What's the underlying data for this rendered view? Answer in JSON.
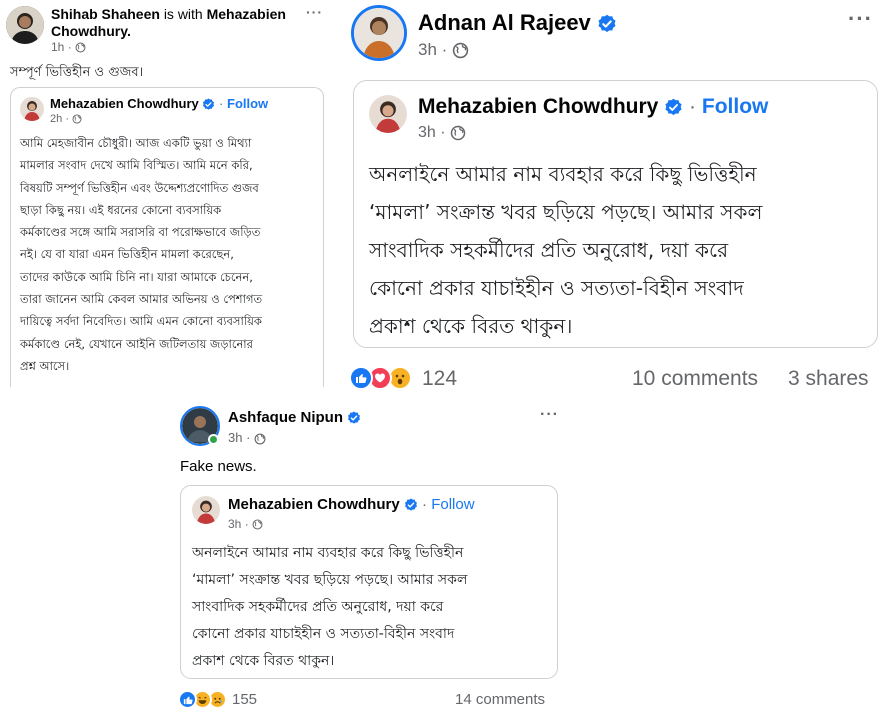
{
  "post1": {
    "author": "Shihab Shaheen",
    "with_text": "is with",
    "tagged": "Mehazabien Chowdhury.",
    "tagged_line1": "Mehazabien",
    "tagged_line2": "Chowdhury.",
    "time": "1h",
    "text": "সম্পূর্ণ ভিত্তিহীন ও গুজব।",
    "shared": {
      "author": "Mehazabien Chowdhury",
      "follow": "Follow",
      "time": "2h",
      "lines": [
        "আমি মেহজাবীন চৌধুরী। আজ একটি ভুয়া ও মিথ্যা",
        "মামলার সংবাদ দেখে আমি বিস্মিত। আমি মনে করি,",
        "বিষয়টি সম্পূর্ণ ভিত্তিহীন এবং উদ্দেশ্যপ্রণোদিত গুজব",
        "ছাড়া কিছু নয়। এই ধরনের কোনো ব্যবসায়িক",
        "কর্মকাণ্ডের সঙ্গে আমি সরাসরি বা পরোক্ষভাবে জড়িত",
        "নই। যে বা যারা এমন ভিত্তিহীন মামলা করেছেন,",
        "তাদের কাউকে আমি চিনি না। যারা আমাকে চেনেন,",
        "তারা জানেন আমি কেবল আমার অভিনয় ও পেশাগত",
        "দায়িত্বে সর্বদা নিবেদিত। আমি এমন কোনো ব্যবসায়িক",
        "কর্মকাণ্ডে নেই, যেখানে আইনি জটিলতায় জড়ানোর",
        "প্রশ্ন আসে।"
      ]
    }
  },
  "post2": {
    "author": "Adnan Al Rajeev",
    "time": "3h",
    "shared": {
      "author": "Mehazabien Chowdhury",
      "follow": "Follow",
      "time": "3h",
      "lines": [
        "অনলাইনে আমার নাম ব্যবহার করে কিছু ভিত্তিহীন",
        "‘মামলা’ সংক্রান্ত খবর ছড়িয়ে পড়ছে। আমার সকল",
        "সাংবাদিক সহকর্মীদের প্রতি অনুরোধ, দয়া করে",
        "কোনো প্রকার যাচাইহীন ও সত্যতা-বিহীন সংবাদ",
        "প্রকাশ থেকে বিরত থাকুন।"
      ]
    },
    "reactions_count": "124",
    "comments": "10 comments",
    "shares": "3 shares"
  },
  "post3": {
    "author": "Ashfaque Nipun",
    "time": "3h",
    "text": "Fake news.",
    "shared": {
      "author": "Mehazabien Chowdhury",
      "follow": "Follow",
      "time": "3h",
      "lines": [
        "অনলাইনে আমার নাম ব্যবহার করে কিছু ভিত্তিহীন",
        "‘মামলা’ সংক্রান্ত খবর ছড়িয়ে পড়ছে। আমার সকল",
        "সাংবাদিক সহকর্মীদের প্রতি অনুরোধ, দয়া করে",
        "কোনো প্রকার যাচাইহীন ও সত্যতা-বিহীন সংবাদ",
        "প্রকাশ থেকে বিরত থাকুন।"
      ]
    },
    "reactions_count": "155",
    "comments": "14 comments"
  },
  "colors": {
    "accent": "#1877f2",
    "meta": "#65676b",
    "border": "#ced0d4",
    "online": "#31a24c"
  }
}
